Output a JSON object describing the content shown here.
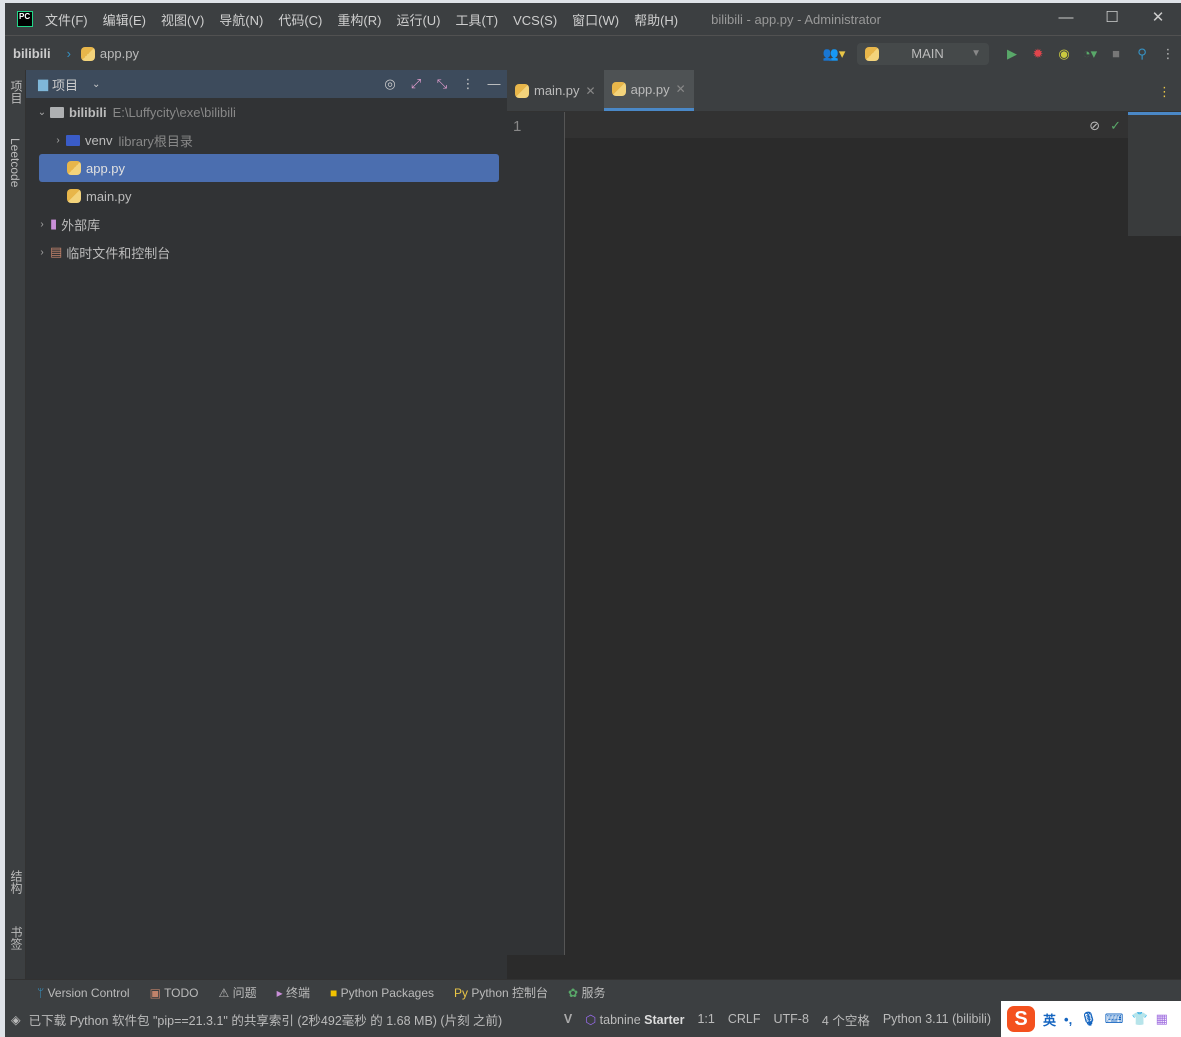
{
  "titlebar": {
    "menu": [
      "文件(F)",
      "编辑(E)",
      "视图(V)",
      "导航(N)",
      "代码(C)",
      "重构(R)",
      "运行(U)",
      "工具(T)",
      "VCS(S)",
      "窗口(W)",
      "帮助(H)"
    ],
    "title": "bilibili - app.py - Administrator",
    "logo": "PC"
  },
  "navbar": {
    "project": "bilibili",
    "file": "app.py",
    "run_config": "MAIN"
  },
  "left_strip": {
    "project": "项目",
    "leetcode": "Leetcode",
    "structure": "结构",
    "bookmarks": "书签"
  },
  "project_panel": {
    "title": "项目",
    "tree": [
      {
        "label": "bilibili",
        "hint": "E:\\Luffycity\\exe\\bilibili"
      },
      {
        "label": "venv",
        "hint": "library根目录"
      },
      {
        "label": "app.py"
      },
      {
        "label": "main.py"
      },
      {
        "label": "外部库"
      },
      {
        "label": "临时文件和控制台"
      }
    ]
  },
  "editor": {
    "tabs": [
      {
        "label": "main.py"
      },
      {
        "label": "app.py",
        "active": true
      }
    ],
    "line_numbers": [
      "1"
    ]
  },
  "toolwindows": [
    "Version Control",
    "TODO",
    "问题",
    "终端",
    "Python Packages",
    "Python 控制台",
    "服务"
  ],
  "status": {
    "message": "已下载 Python 软件包 \"pip==21.3.1\" 的共享索引 (2秒492毫秒 的 1.68 MB) (片刻 之前)",
    "tabnine": "tabnine",
    "tabnine_plan": "Starter",
    "position": "1:1",
    "line_sep": "CRLF",
    "encoding": "UTF-8",
    "indent": "4 个空格",
    "interpreter": "Python 3.11 (bilibili)"
  },
  "ime": {
    "logo": "S",
    "lang": "英"
  },
  "colors": {
    "selection": "#4b6eaf",
    "tab_underline": "#4a88c7",
    "run": "#59a869",
    "debug": "#e0454c"
  }
}
